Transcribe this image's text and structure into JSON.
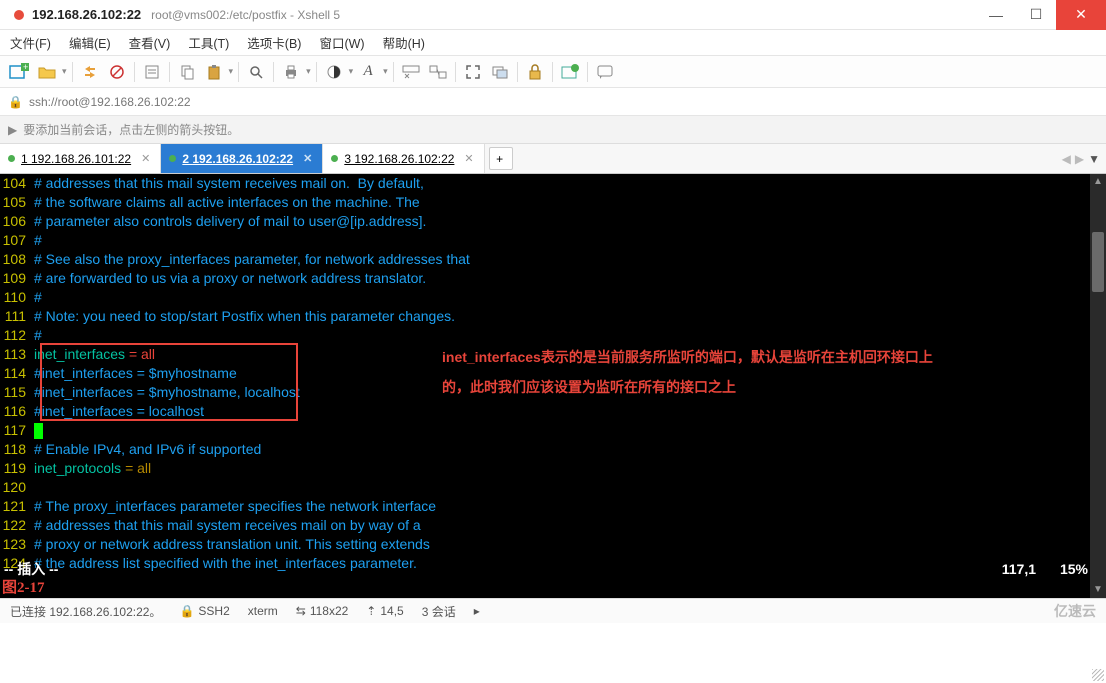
{
  "title": {
    "ip": "192.168.26.102:22",
    "path": "root@vms002:/etc/postfix - Xshell 5"
  },
  "menu": [
    "文件(F)",
    "编辑(E)",
    "查看(V)",
    "工具(T)",
    "选项卡(B)",
    "窗口(W)",
    "帮助(H)"
  ],
  "addr": "ssh://root@192.168.26.102:22",
  "hint": "要添加当前会话，点击左侧的箭头按钮。",
  "tabs": [
    {
      "label": "1 192.168.26.101:22",
      "active": false
    },
    {
      "label": "2 192.168.26.102:22",
      "active": true
    },
    {
      "label": "3 192.168.26.102:22",
      "active": false
    }
  ],
  "lines": [
    {
      "n": "104",
      "t": "# addresses that this mail system receives mail on.  By default,",
      "c": "cmt"
    },
    {
      "n": "105",
      "t": "# the software claims all active interfaces on the machine. The",
      "c": "cmt"
    },
    {
      "n": "106",
      "t": "# parameter also controls delivery of mail to user@[ip.address].",
      "c": "cmt"
    },
    {
      "n": "107",
      "t": "#",
      "c": "cmt"
    },
    {
      "n": "108",
      "t": "# See also the proxy_interfaces parameter, for network addresses that",
      "c": "cmt"
    },
    {
      "n": "109",
      "t": "# are forwarded to us via a proxy or network address translator.",
      "c": "cmt"
    },
    {
      "n": "110",
      "t": "#",
      "c": "cmt"
    },
    {
      "n": "111",
      "t": "# Note: you need to stop/start Postfix when this parameter changes.",
      "c": "cmt"
    },
    {
      "n": "112",
      "t": "#",
      "c": "cmt"
    },
    {
      "n": "113",
      "seg": [
        {
          "t": "inet_interfaces ",
          "c": "kw"
        },
        {
          "t": "= all",
          "c": "valr"
        }
      ]
    },
    {
      "n": "114",
      "seg": [
        {
          "t": "#inet_interfaces ",
          "c": "cmt"
        },
        {
          "t": "= $myhostname",
          "c": "cmt"
        }
      ]
    },
    {
      "n": "115",
      "seg": [
        {
          "t": "#inet_interfaces ",
          "c": "cmt"
        },
        {
          "t": "= $myhostname, localhost",
          "c": "cmt"
        }
      ]
    },
    {
      "n": "116",
      "seg": [
        {
          "t": "#inet_interfaces ",
          "c": "cmt"
        },
        {
          "t": "= localhost",
          "c": "cmt"
        }
      ]
    },
    {
      "n": "117",
      "cursor": true
    },
    {
      "n": "118",
      "t": "# Enable IPv4, and IPv6 if supported",
      "c": "cmt"
    },
    {
      "n": "119",
      "seg": [
        {
          "t": "inet_protocols ",
          "c": "kw"
        },
        {
          "t": "= all",
          "c": "val"
        }
      ]
    },
    {
      "n": "120",
      "t": "",
      "c": ""
    },
    {
      "n": "121",
      "t": "# The proxy_interfaces parameter specifies the network interface",
      "c": "cmt"
    },
    {
      "n": "122",
      "t": "# addresses that this mail system receives mail on by way of a",
      "c": "cmt"
    },
    {
      "n": "123",
      "t": "# proxy or network address translation unit. This setting extends",
      "c": "cmt"
    },
    {
      "n": "124",
      "t": "# the address list specified with the inet_interfaces parameter.",
      "c": "cmt"
    }
  ],
  "vim": {
    "mode": "-- 插入 --",
    "pos": "117,1",
    "pct": "15%"
  },
  "figure": "图2-17",
  "annotation": {
    "l1": "inet_interfaces表示的是当前服务所监听的端口，默认是监听在主机回环接口上",
    "l2": "的，此时我们应该设置为监听在所有的接口之上"
  },
  "status": {
    "conn": "已连接 192.168.26.102:22。",
    "proto": "SSH2",
    "term": "xterm",
    "size": "118x22",
    "cursor": "14,5",
    "sess": "3 会话"
  },
  "logo": "亿速云",
  "icons": {
    "sizepre": "⇆",
    "curpre": "⇡",
    "lock": "🔒",
    "arrow": "▶"
  }
}
